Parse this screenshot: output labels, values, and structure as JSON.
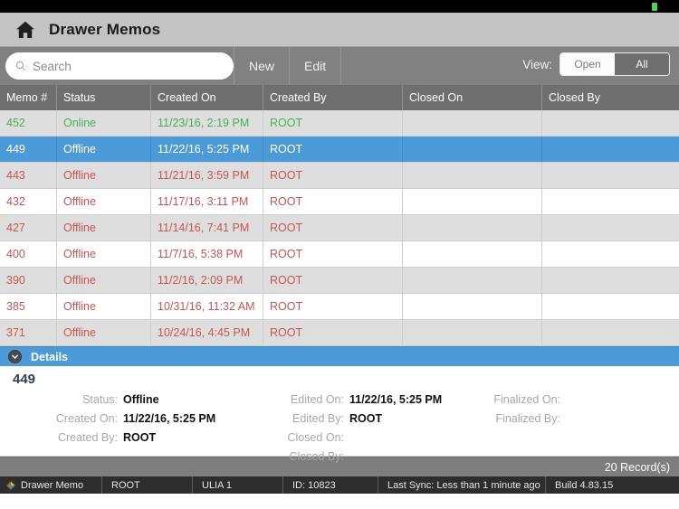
{
  "window": {
    "battery_indicator": "battery-full"
  },
  "titlebar": {
    "home_icon": "home-icon",
    "title": "Drawer Memos"
  },
  "toolbar": {
    "search_placeholder": "Search",
    "search_value": "",
    "search_icon": "search-icon",
    "new_label": "New",
    "edit_label": "Edit",
    "view_label": "View:",
    "view_options": [
      "Open",
      "All"
    ],
    "view_selected": "Open"
  },
  "table": {
    "columns": [
      "Memo #",
      "Status",
      "Created On",
      "Created By",
      "Closed On",
      "Closed By"
    ],
    "rows": [
      {
        "memo": "452",
        "status": "Online",
        "created_on": "11/23/16, 2:19 PM",
        "created_by": "ROOT",
        "closed_on": "",
        "closed_by": "",
        "state": "online",
        "selected": false
      },
      {
        "memo": "449",
        "status": "Offline",
        "created_on": "11/22/16, 5:25 PM",
        "created_by": "ROOT",
        "closed_on": "",
        "closed_by": "",
        "state": "offline",
        "selected": true
      },
      {
        "memo": "443",
        "status": "Offline",
        "created_on": "11/21/16, 3:59 PM",
        "created_by": "ROOT",
        "closed_on": "",
        "closed_by": "",
        "state": "offline",
        "selected": false
      },
      {
        "memo": "432",
        "status": "Offline",
        "created_on": "11/17/16, 3:11 PM",
        "created_by": "ROOT",
        "closed_on": "",
        "closed_by": "",
        "state": "offline",
        "selected": false
      },
      {
        "memo": "427",
        "status": "Offline",
        "created_on": "11/14/16, 7:41 PM",
        "created_by": "ROOT",
        "closed_on": "",
        "closed_by": "",
        "state": "offline",
        "selected": false
      },
      {
        "memo": "400",
        "status": "Offline",
        "created_on": "11/7/16, 5:38 PM",
        "created_by": "ROOT",
        "closed_on": "",
        "closed_by": "",
        "state": "offline",
        "selected": false
      },
      {
        "memo": "390",
        "status": "Offline",
        "created_on": "11/2/16, 2:09 PM",
        "created_by": "ROOT",
        "closed_on": "",
        "closed_by": "",
        "state": "offline",
        "selected": false
      },
      {
        "memo": "385",
        "status": "Offline",
        "created_on": "10/31/16, 11:32 AM",
        "created_by": "ROOT",
        "closed_on": "",
        "closed_by": "",
        "state": "offline",
        "selected": false
      },
      {
        "memo": "371",
        "status": "Offline",
        "created_on": "10/24/16, 4:45 PM",
        "created_by": "ROOT",
        "closed_on": "",
        "closed_by": "",
        "state": "offline",
        "selected": false
      }
    ]
  },
  "details": {
    "section_title": "Details",
    "collapse_icon": "chevron-down-icon",
    "record_id": "449",
    "fields": {
      "status_label": "Status:",
      "status_value": "Offline",
      "created_on_label": "Created On:",
      "created_on_value": "11/22/16, 5:25 PM",
      "created_by_label": "Created By:",
      "created_by_value": "ROOT",
      "edited_on_label": "Edited On:",
      "edited_on_value": "11/22/16, 5:25 PM",
      "edited_by_label": "Edited By:",
      "edited_by_value": "ROOT",
      "closed_on_label": "Closed On:",
      "closed_on_value": "",
      "closed_by_label": "Closed By:",
      "closed_by_value": "",
      "finalized_on_label": "Finalized On:",
      "finalized_on_value": "",
      "finalized_by_label": "Finalized By:",
      "finalized_by_value": ""
    }
  },
  "record_bar": {
    "count_text": "20 Record(s)"
  },
  "statusbar": {
    "logo_icon": "app-logo-icon",
    "module": "Drawer Memo",
    "user": "ROOT",
    "terminal": "ULIA 1",
    "id": "ID: 10823",
    "last_sync": "Last Sync: Less than 1 minute ago",
    "build": "Build 4.83.15"
  },
  "colors": {
    "selection_blue": "#4a9bd8",
    "status_online_green": "#4aae52",
    "status_offline_red": "#c9544f",
    "toolbar_gray": "#818181",
    "header_gray": "#6f6f6f"
  }
}
